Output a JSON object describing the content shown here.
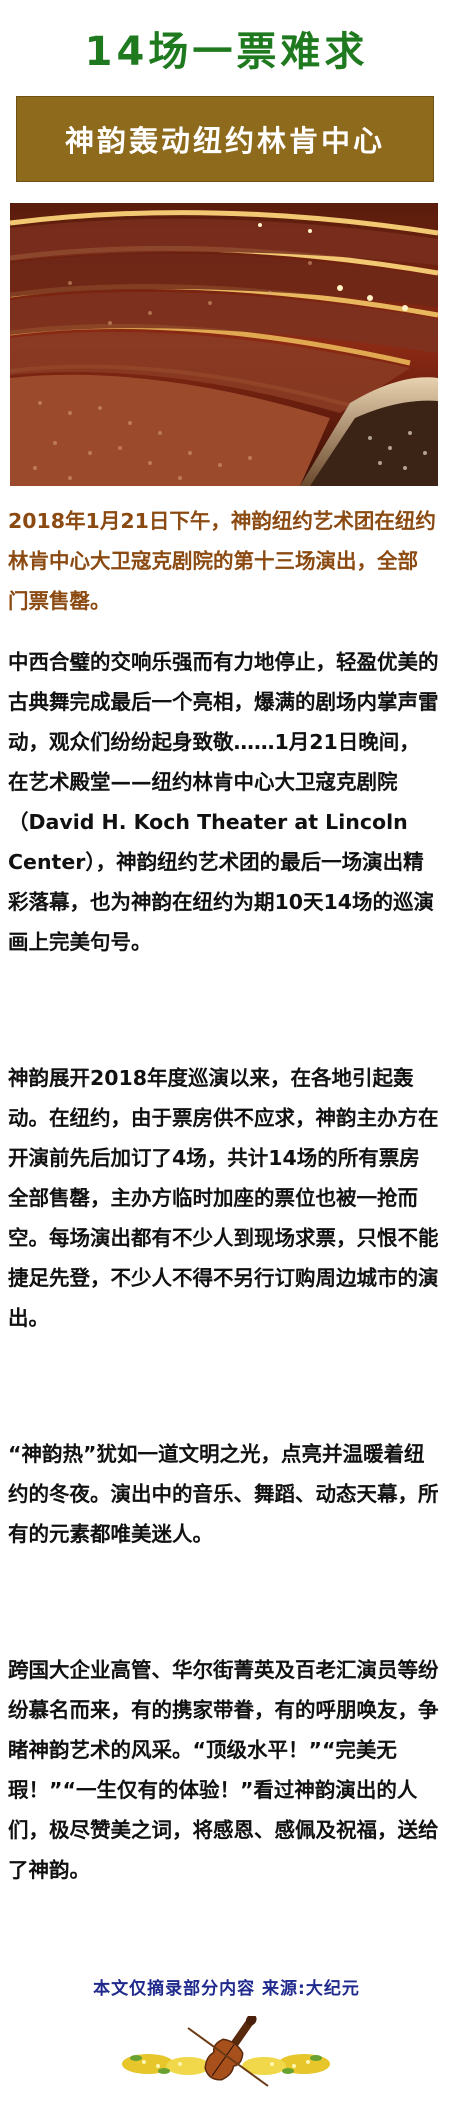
{
  "title": "14场一票难求",
  "banner": "神韵轰动纽约林肯中心",
  "lead": "2018年1月21日下午，神韵纽约艺术团在纽约林肯中心大卫寇克剧院的第十三场演出，全部门票售罄。",
  "paragraphs": [
    "中西合璧的交响乐强而有力地停止，轻盈优美的古典舞完成最后一个亮相，爆满的剧场内掌声雷动，观众们纷纷起身致敬……1月21日晚间，在艺术殿堂——纽约林肯中心大卫寇克剧院（David H. Koch Theater at Lincoln Center），神韵纽约艺术团的最后一场演出精彩落幕，也为神韵在纽约为期10天14场的巡演画上完美句号。",
    "神韵展开2018年度巡演以来，在各地引起轰动。在纽约，由于票房供不应求，神韵主办方在开演前先后加订了4场，共计14场的所有票房全部售罄，主办方临时加座的票位也被一抢而空。每场演出都有不少人到现场求票，只恨不能捷足先登，不少人不得不另行订购周边城市的演出。",
    "“神韵热”犹如一道文明之光，点亮并温暖着纽约的冬夜。演出中的音乐、舞蹈、动态天幕，所有的元素都唯美迷人。",
    "跨国大企业高管、华尔街菁英及百老汇演员等纷纷慕名而来，有的携家带眷，有的呼朋唤友，争睹神韵艺术的风采。“顶级水平！”“完美无瑕！”“一生仅有的体验！”看过神韵演出的人们，极尽赞美之词，将感恩、感佩及祝福，送给了神韵。"
  ],
  "footer": "本文仅摘录部分内容  来源:大纪元",
  "colors": {
    "title": "#1f7a1f",
    "banner_bg": "#8e6a1d",
    "lead": "#8b4a12",
    "footer": "#1f2a8c"
  },
  "images": {
    "photo": "theater-audience-photo",
    "ornament": "violin-with-flowers-ornament"
  }
}
